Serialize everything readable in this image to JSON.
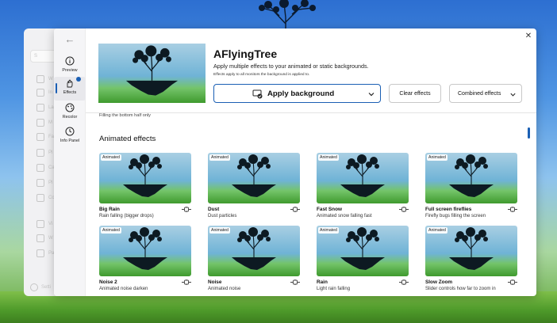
{
  "background_app": {
    "search_placeholder": "S",
    "nav_labels": [
      "W",
      "In",
      "La",
      "M",
      "Fa",
      "Pl",
      "Ca",
      "Pl",
      "Co",
      "Vi",
      "W",
      "Pa"
    ],
    "settings_label": "Setti"
  },
  "dialog": {
    "rail": {
      "items": [
        {
          "label": "Preview",
          "icon": "info-circle-icon"
        },
        {
          "label": "Effects",
          "icon": "effects-hand-icon",
          "active": true
        },
        {
          "label": "Recolor",
          "icon": "palette-icon"
        },
        {
          "label": "Info Panel",
          "icon": "clock-icon"
        }
      ]
    },
    "header": {
      "title": "AFlyingTree",
      "subtitle": "Apply multiple effects to your animated or static backgrounds.",
      "note": "Effects apply to all monitors the background is applied to."
    },
    "buttons": {
      "apply": "Apply background",
      "clear": "Clear effects",
      "combined": "Combined effects"
    },
    "cut_text": "Filling the bottom half only",
    "section_title": "Animated effects",
    "effects": [
      {
        "tag": "Animated",
        "name": "Big Rain",
        "desc": "Rain falling (bigger drops)"
      },
      {
        "tag": "Animated",
        "name": "Dust",
        "desc": "Dust particles"
      },
      {
        "tag": "Animated",
        "name": "Fast Snow",
        "desc": "Animated snow falling fast"
      },
      {
        "tag": "Animated",
        "name": "Full screen fireflies",
        "desc": "Firefly bugs filling the screen"
      },
      {
        "tag": "Animated",
        "name": "Noise 2",
        "desc": "Animated noise darken"
      },
      {
        "tag": "Animated",
        "name": "Noise",
        "desc": "Animated noise"
      },
      {
        "tag": "Animated",
        "name": "Rain",
        "desc": "Light rain falling"
      },
      {
        "tag": "Animated",
        "name": "Slow Zoom",
        "desc": "Slider controls how far to zoom in"
      }
    ]
  },
  "colors": {
    "accent": "#1a5fb4",
    "sky_top": "#2d6fd1",
    "grass": "#4e9a2a"
  }
}
